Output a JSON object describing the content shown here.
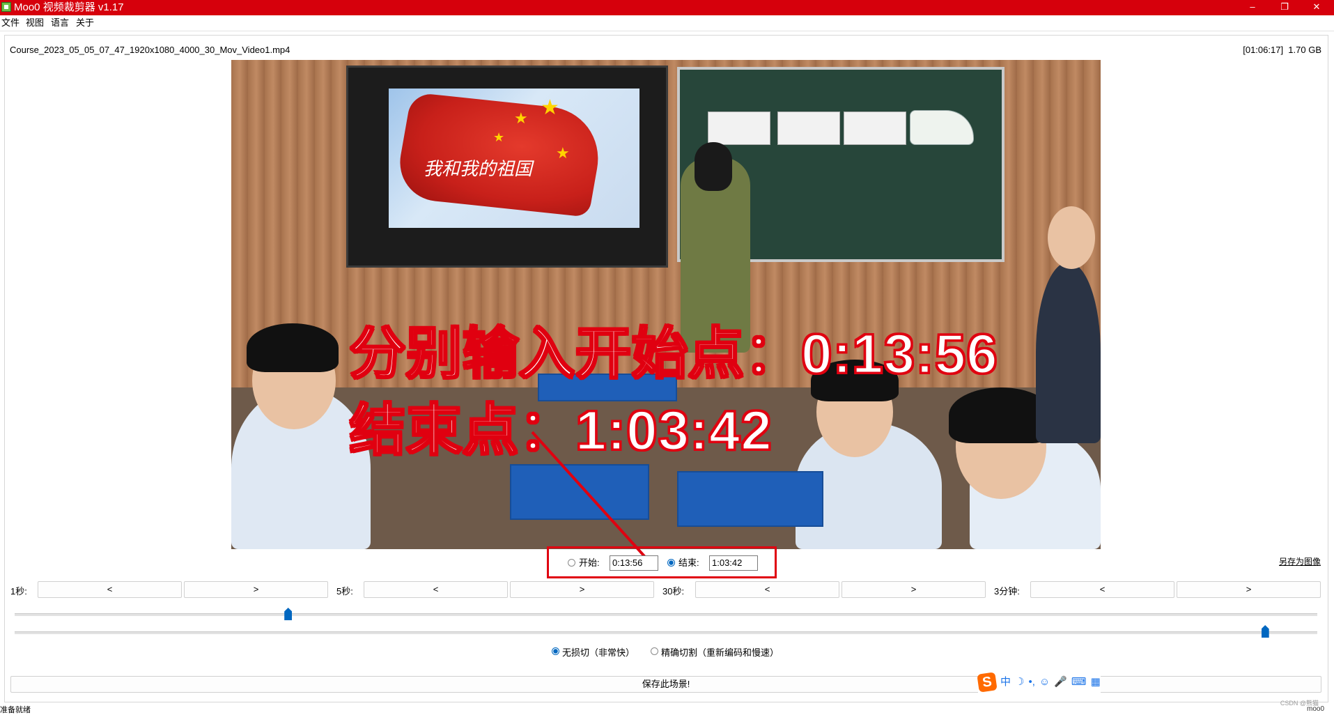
{
  "window": {
    "title": "Moo0 视频裁剪器 v1.17",
    "controls": [
      "–",
      "❐",
      "✕"
    ]
  },
  "menu": [
    "文件",
    "视图",
    "语言",
    "关于"
  ],
  "file": {
    "name": "Course_2023_05_05_07_47_1920x1080_4000_30_Mov_Video1.mp4",
    "duration": "[01:06:17]",
    "size": "1.70 GB"
  },
  "video": {
    "overlay_line1": "分别输入开始点：0:13:56",
    "overlay_line2": "结束点：1:03:42",
    "tv_text": "我和我的祖国"
  },
  "range": {
    "start_label": "开始:",
    "start_value": "0:13:56",
    "start_selected": false,
    "end_label": "结束:",
    "end_value": "1:03:42",
    "end_selected": true
  },
  "save_image_link": "另存为图像",
  "steps": [
    {
      "label": "1秒:",
      "back": "<",
      "fwd": ">"
    },
    {
      "label": "5秒:",
      "back": "<",
      "fwd": ">"
    },
    {
      "label": "30秒:",
      "back": "<",
      "fwd": ">"
    },
    {
      "label": "3分钟:",
      "back": "<",
      "fwd": ">"
    }
  ],
  "sliders": {
    "start_position_fraction": 0.21,
    "end_position_fraction": 0.96
  },
  "modes": {
    "lossless": "无损切（非常快）",
    "lossless_selected": true,
    "precise": "精确切割（重新编码和慢速）",
    "precise_selected": false
  },
  "save_button": "保存此场景!",
  "ime_toolbar": {
    "logo": "S",
    "items": [
      "中",
      "☽",
      "•,",
      "☺",
      "🎤",
      "⌨",
      "▦"
    ]
  },
  "status_text": "准备就绪",
  "watermark": "CSDN @熊猫",
  "status_right": "moo0",
  "colors": {
    "titlebar": "#d6000c",
    "annotation": "#e00010",
    "accent": "#0067c0"
  }
}
